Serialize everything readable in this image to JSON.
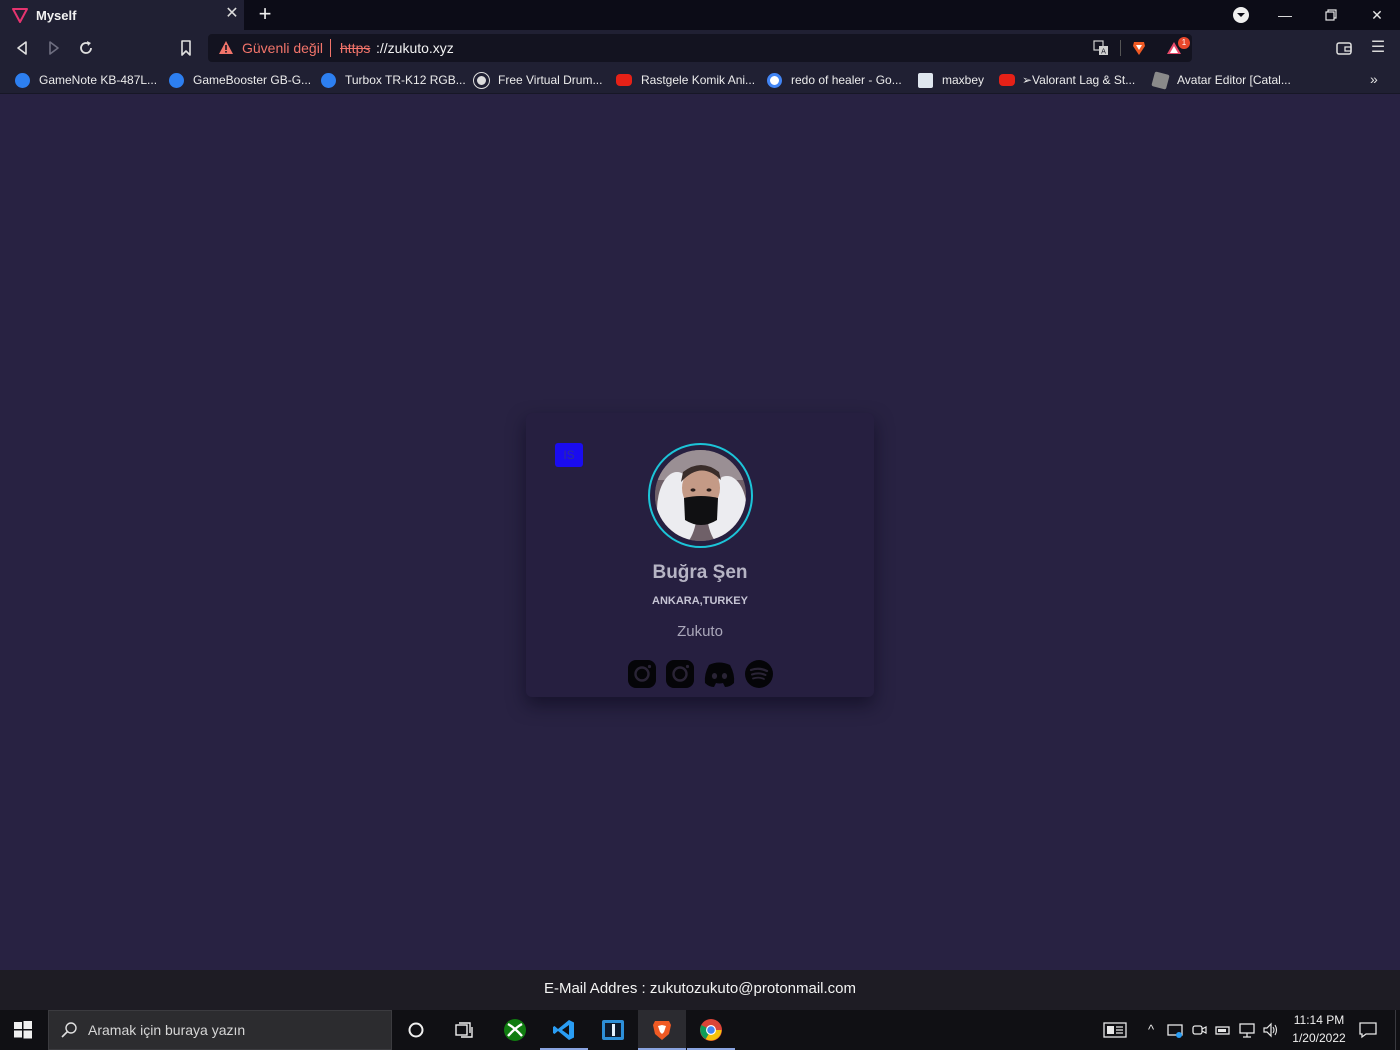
{
  "browser": {
    "tab": {
      "title": "Myself",
      "favicon": "brave-triangle-icon"
    },
    "window_controls": [
      "profile-dropdown-icon",
      "minimize-icon",
      "restore-icon",
      "close-icon"
    ],
    "address_bar": {
      "security_warning": "Güvenli değil",
      "scheme": "https",
      "separator": "://",
      "host": "zukuto.xyz",
      "brave_shields_badge": "1"
    },
    "bookmarks": [
      {
        "label": "GameNote KB-487L...",
        "icon": "blue-check-icon"
      },
      {
        "label": "GameBooster GB-G...",
        "icon": "blue-check-icon"
      },
      {
        "label": "Turbox TR-K12 RGB...",
        "icon": "blue-check-icon"
      },
      {
        "label": "Free Virtual Drum...",
        "icon": "globe-icon"
      },
      {
        "label": "Rastgele Komik Ani...",
        "icon": "youtube-icon"
      },
      {
        "label": "redo of healer - Go...",
        "icon": "google-icon"
      },
      {
        "label": "maxbey",
        "icon": "site-icon"
      },
      {
        "label": "➢Valorant Lag & St...",
        "icon": "youtube-icon"
      },
      {
        "label": "Avatar Editor [Catal...",
        "icon": "roblox-icon"
      }
    ],
    "bookmarks_overflow": "»"
  },
  "profile": {
    "badge": "IS",
    "name": "Buğra Şen",
    "location": "ANKARA,TURKEY",
    "handle": "Zukuto",
    "social_links": [
      "instagram-icon",
      "instagram-icon",
      "discord-icon",
      "spotify-icon"
    ],
    "accent_color": "#1cc4d8"
  },
  "footer": {
    "label": "E-Mail Addres :",
    "email": "zukutozukuto@protonmail.com"
  },
  "taskbar": {
    "search_placeholder": "Aramak için buraya yazın",
    "time": "11:14 PM",
    "date": "1/20/2022"
  },
  "colors": {
    "page_background": "#282242",
    "card_background": "#261f40",
    "badge_background": "#1a0cf0",
    "insecure_warning": "#f2746a"
  }
}
